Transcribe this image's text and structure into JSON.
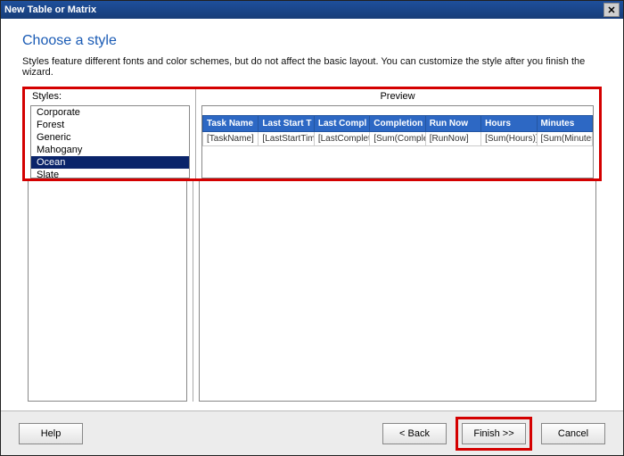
{
  "window": {
    "title": "New Table or Matrix"
  },
  "page": {
    "heading": "Choose a style",
    "description": "Styles feature different fonts and color schemes, but do not affect the basic layout. You can customize the style after you finish the wizard."
  },
  "styles": {
    "label": "Styles:",
    "items": [
      {
        "name": "Corporate",
        "selected": false
      },
      {
        "name": "Forest",
        "selected": false
      },
      {
        "name": "Generic",
        "selected": false
      },
      {
        "name": "Mahogany",
        "selected": false
      },
      {
        "name": "Ocean",
        "selected": true
      },
      {
        "name": "Slate",
        "selected": false
      }
    ]
  },
  "preview": {
    "label": "Preview",
    "columns": [
      "Task Name",
      "Last Start T",
      "Last Compl",
      "Completion",
      "Run Now",
      "Hours",
      "Minutes"
    ],
    "rows": [
      [
        "[TaskName]",
        "[LastStartTime]",
        "[LastCompletion",
        "[Sum(Completio",
        "[RunNow]",
        "[Sum(Hours)]",
        "[Sum(Minutes)]"
      ]
    ]
  },
  "buttons": {
    "help": "Help",
    "back": "< Back",
    "finish": "Finish >>",
    "cancel": "Cancel"
  }
}
